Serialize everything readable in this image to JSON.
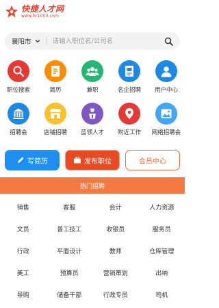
{
  "header": {
    "logo_text": "快捷人才网",
    "logo_url": "www.hr1000.com"
  },
  "search": {
    "city": "襄阳市",
    "placeholder": "请输入职位名/公司名"
  },
  "grid": [
    [
      {
        "label": "职位搜索",
        "icon": "search-icon",
        "color": "#e53935"
      },
      {
        "label": "简历",
        "icon": "document-icon",
        "color": "#fb8c00"
      },
      {
        "label": "兼职",
        "icon": "people-icon",
        "color": "#26b673"
      },
      {
        "label": "名企招聘",
        "icon": "building-card-icon",
        "color": "#1e88e5"
      },
      {
        "label": "用户中心",
        "icon": "user-icon",
        "color": "#1e88e5"
      }
    ],
    [
      {
        "label": "招聘会",
        "icon": "hall-icon",
        "color": "#1e88e5"
      },
      {
        "label": "店铺招聘",
        "icon": "shop-icon",
        "color": "#fbc02d"
      },
      {
        "label": "蓝领人才",
        "icon": "worker-icon",
        "color": "#7e57c2"
      },
      {
        "label": "附近工作",
        "icon": "location-pin-icon",
        "color": "#e53935"
      },
      {
        "label": "网络招聘会",
        "icon": "image-icon",
        "color": "#42a5f5"
      }
    ]
  ],
  "actions": {
    "write_resume": "写简历",
    "post_job": "发布职位",
    "member_center": "会员中心"
  },
  "colors": {
    "brand_red": "#e8412a",
    "accent_orange": "#f47a44",
    "blue": "#1e8ff0"
  },
  "hot_section": {
    "title": "热门招聘"
  },
  "hot_tags": [
    [
      "销售",
      "客服",
      "会计",
      "人力资源"
    ],
    [
      "文员",
      "普工技工",
      "收银员",
      "服务员"
    ],
    [
      "行政",
      "平面设计",
      "教师",
      "仓库管理"
    ],
    [
      "美工",
      "预算员",
      "营销策划",
      "出纳"
    ],
    [
      "导购",
      "储备干部",
      "行政专员",
      "司机"
    ]
  ]
}
